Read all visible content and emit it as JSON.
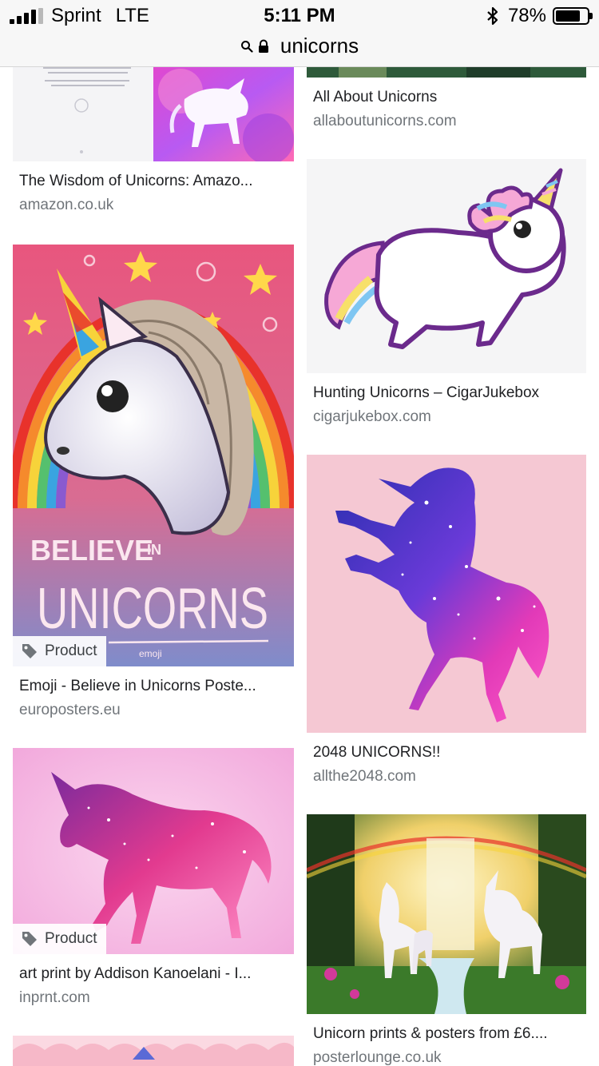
{
  "status_bar": {
    "carrier": "Sprint",
    "network": "LTE",
    "time": "5:11 PM",
    "battery_percent": "78%",
    "battery_level": 0.78,
    "signal_bars": 4,
    "signal_bars_total": 5
  },
  "address_bar": {
    "query": "unicorns",
    "icons": [
      "search-icon",
      "lock-icon"
    ]
  },
  "results": {
    "left": [
      {
        "title": "The Wisdom of Unicorns: Amazo...",
        "site": "amazon.co.uk",
        "badge": ""
      },
      {
        "title": "Emoji - Believe in Unicorns Poste...",
        "site": "europosters.eu",
        "badge": "Product",
        "poster_line1": "BELIEVE",
        "poster_line1_small": "IN",
        "poster_line2": "UNICORNS",
        "brand": "emoji"
      },
      {
        "title": "art print by Addison Kanoelani - I...",
        "site": "inprnt.com",
        "badge": "Product"
      }
    ],
    "right": [
      {
        "title": "All About Unicorns",
        "site": "allaboutunicorns.com",
        "badge": ""
      },
      {
        "title": "Hunting Unicorns – CigarJukebox",
        "site": "cigarjukebox.com",
        "badge": ""
      },
      {
        "title": "2048 UNICORNS!!",
        "site": "allthe2048.com",
        "badge": ""
      },
      {
        "title": "Unicorn prints & posters from £6....",
        "site": "posterlounge.co.uk",
        "badge": ""
      }
    ]
  },
  "colors": {
    "title_text": "#202124",
    "site_text": "#70757a",
    "chrome_bg": "#f7f7f7"
  }
}
